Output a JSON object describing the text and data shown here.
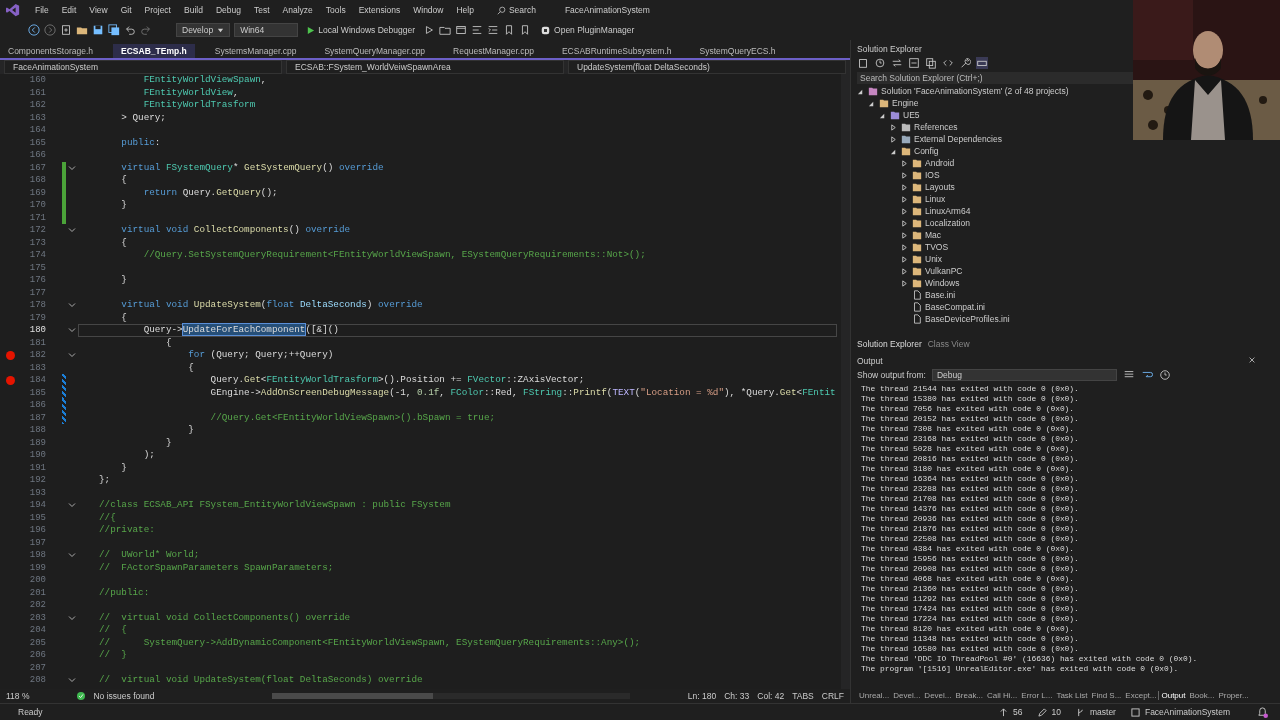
{
  "menu": [
    "File",
    "Edit",
    "View",
    "Git",
    "Project",
    "Build",
    "Debug",
    "Test",
    "Analyze",
    "Tools",
    "Extensions",
    "Window",
    "Help"
  ],
  "search_label": "Search",
  "window_title": "FaceAnimationSystem",
  "toolbar": {
    "configuration": "Develop",
    "platform": "Win64",
    "debugger": "Local Windows Debugger",
    "plugin_button": "Open PluginManager"
  },
  "tabs": [
    {
      "label": "ComponentsStorage.h",
      "selected": false
    },
    {
      "label": "ECSAB_TEmp.h",
      "selected": true
    },
    {
      "label": "SystemsManager.cpp",
      "selected": false
    },
    {
      "label": "SystemQueryManager.cpp",
      "selected": false
    },
    {
      "label": "RequestManager.cpp",
      "selected": false
    },
    {
      "label": "ECSABRuntimeSubsystem.h",
      "selected": false
    },
    {
      "label": "SystemQueryECS.h",
      "selected": false
    }
  ],
  "navigation": {
    "project": "FaceAnimationSystem",
    "scope": "ECSAB::FSystem_WorldVeiwSpawnArea",
    "member": "UpdateSystem(float DeltaSeconds)"
  },
  "code_lines": [
    {
      "n": "160",
      "fold": false,
      "breakpoint": false,
      "current": false,
      "saved_change": false,
      "unsaved_change": false,
      "code": [
        {
          "kind": "type",
          "text": "        FEntityWorldViewSpawn"
        },
        {
          "kind": "plain",
          "text": ","
        }
      ]
    },
    {
      "n": "161",
      "fold": false,
      "breakpoint": false,
      "current": false,
      "saved_change": false,
      "unsaved_change": false,
      "code": [
        {
          "kind": "type",
          "text": "        FEntityWorldView"
        },
        {
          "kind": "plain",
          "text": ","
        }
      ]
    },
    {
      "n": "162",
      "fold": false,
      "breakpoint": false,
      "current": false,
      "saved_change": false,
      "unsaved_change": false,
      "code": [
        {
          "kind": "type",
          "text": "        FEntityWorldTrasform"
        }
      ]
    },
    {
      "n": "163",
      "fold": false,
      "breakpoint": false,
      "current": false,
      "saved_change": false,
      "unsaved_change": false,
      "code": [
        {
          "kind": "plain",
          "text": "    > Query;"
        }
      ]
    },
    {
      "n": "164",
      "fold": false,
      "breakpoint": false,
      "current": false,
      "saved_change": false,
      "unsaved_change": false
    },
    {
      "n": "165",
      "fold": false,
      "breakpoint": false,
      "current": false,
      "saved_change": false,
      "unsaved_change": false,
      "code": [
        {
          "kind": "keyword",
          "text": "    public"
        },
        {
          "kind": "plain",
          "text": ":"
        }
      ]
    },
    {
      "n": "166",
      "fold": false,
      "breakpoint": false,
      "current": false,
      "saved_change": false,
      "unsaved_change": false
    },
    {
      "n": "167",
      "fold": true,
      "breakpoint": false,
      "current": false,
      "saved_change": true,
      "unsaved_change": false,
      "code": [
        {
          "kind": "keyword",
          "text": "    virtual "
        },
        {
          "kind": "type",
          "text": "FSystemQuery"
        },
        {
          "kind": "plain",
          "text": "* "
        },
        {
          "kind": "function",
          "text": "GetSystemQuery"
        },
        {
          "kind": "plain",
          "text": "() "
        },
        {
          "kind": "keyword",
          "text": "override"
        }
      ]
    },
    {
      "n": "168",
      "fold": false,
      "breakpoint": false,
      "current": false,
      "saved_change": true,
      "unsaved_change": false,
      "code": [
        {
          "kind": "plain",
          "text": "    {"
        }
      ]
    },
    {
      "n": "169",
      "fold": false,
      "breakpoint": false,
      "current": false,
      "saved_change": true,
      "unsaved_change": false,
      "code": [
        {
          "kind": "keyword",
          "text": "        return "
        },
        {
          "kind": "plain",
          "text": "Query."
        },
        {
          "kind": "function",
          "text": "GetQuery"
        },
        {
          "kind": "plain",
          "text": "();"
        }
      ]
    },
    {
      "n": "170",
      "fold": false,
      "breakpoint": false,
      "current": false,
      "saved_change": true,
      "unsaved_change": false,
      "code": [
        {
          "kind": "plain",
          "text": "    }"
        }
      ]
    },
    {
      "n": "171",
      "fold": false,
      "breakpoint": false,
      "current": false,
      "saved_change": true,
      "unsaved_change": false
    },
    {
      "n": "172",
      "fold": true,
      "breakpoint": false,
      "current": false,
      "saved_change": false,
      "unsaved_change": false,
      "code": [
        {
          "kind": "keyword",
          "text": "    virtual void "
        },
        {
          "kind": "function",
          "text": "CollectComponents"
        },
        {
          "kind": "plain",
          "text": "() "
        },
        {
          "kind": "keyword",
          "text": "override"
        }
      ]
    },
    {
      "n": "173",
      "fold": false,
      "breakpoint": false,
      "current": false,
      "saved_change": false,
      "unsaved_change": false,
      "code": [
        {
          "kind": "plain",
          "text": "    {"
        }
      ]
    },
    {
      "n": "174",
      "fold": false,
      "breakpoint": false,
      "current": false,
      "saved_change": false,
      "unsaved_change": false,
      "code": [
        {
          "kind": "comment",
          "text": "        //Query.SetSystemQueryRequirement<FEntityWorldViewSpawn, ESystemQueryRequirements::Not>();"
        }
      ]
    },
    {
      "n": "175",
      "fold": false,
      "breakpoint": false,
      "current": false,
      "saved_change": false,
      "unsaved_change": false
    },
    {
      "n": "176",
      "fold": false,
      "breakpoint": false,
      "current": false,
      "saved_change": false,
      "unsaved_change": false,
      "code": [
        {
          "kind": "plain",
          "text": "    }"
        }
      ]
    },
    {
      "n": "177",
      "fold": false,
      "breakpoint": false,
      "current": false,
      "saved_change": false,
      "unsaved_change": false
    },
    {
      "n": "178",
      "fold": true,
      "breakpoint": false,
      "current": false,
      "saved_change": false,
      "unsaved_change": false,
      "code": [
        {
          "kind": "keyword",
          "text": "    virtual void "
        },
        {
          "kind": "function",
          "text": "UpdateSystem"
        },
        {
          "kind": "plain",
          "text": "("
        },
        {
          "kind": "keyword",
          "text": "float "
        },
        {
          "kind": "variable",
          "text": "DeltaSeconds"
        },
        {
          "kind": "plain",
          "text": ") "
        },
        {
          "kind": "keyword",
          "text": "override"
        }
      ]
    },
    {
      "n": "179",
      "fold": false,
      "breakpoint": false,
      "current": false,
      "saved_change": false,
      "unsaved_change": false,
      "code": [
        {
          "kind": "plain",
          "text": "    {"
        }
      ]
    },
    {
      "n": "180",
      "fold": true,
      "breakpoint": false,
      "current": true,
      "saved_change": false,
      "unsaved_change": false,
      "code": [
        {
          "kind": "plain",
          "text": "        Query->"
        },
        {
          "kind": "selection",
          "text": "UpdateForEachComponent"
        },
        {
          "kind": "plain",
          "text": "([&]()"
        }
      ]
    },
    {
      "n": "181",
      "fold": false,
      "breakpoint": false,
      "current": false,
      "saved_change": false,
      "unsaved_change": false,
      "code": [
        {
          "kind": "plain",
          "text": "            {"
        }
      ]
    },
    {
      "n": "182",
      "fold": true,
      "breakpoint": true,
      "current": false,
      "saved_change": false,
      "unsaved_change": false,
      "code": [
        {
          "kind": "keyword",
          "text": "                for "
        },
        {
          "kind": "plain",
          "text": "(Query; Query;++Query)"
        }
      ]
    },
    {
      "n": "183",
      "fold": false,
      "breakpoint": false,
      "current": false,
      "saved_change": false,
      "unsaved_change": false,
      "code": [
        {
          "kind": "plain",
          "text": "                {"
        }
      ]
    },
    {
      "n": "184",
      "fold": false,
      "breakpoint": true,
      "current": false,
      "saved_change": false,
      "unsaved_change": true,
      "code": [
        {
          "kind": "plain",
          "text": "                    Query."
        },
        {
          "kind": "function",
          "text": "Get"
        },
        {
          "kind": "plain",
          "text": "<"
        },
        {
          "kind": "type",
          "text": "FEntityWorldTrasform"
        },
        {
          "kind": "plain",
          "text": ">().Position += "
        },
        {
          "kind": "type",
          "text": "FVector"
        },
        {
          "kind": "plain",
          "text": "::ZAxisVector;"
        }
      ]
    },
    {
      "n": "185",
      "fold": false,
      "breakpoint": false,
      "current": false,
      "saved_change": false,
      "unsaved_change": true,
      "code": [
        {
          "kind": "plain",
          "text": "                    GEngine->"
        },
        {
          "kind": "function",
          "text": "AddOnScreenDebugMessage"
        },
        {
          "kind": "plain",
          "text": "(-1, "
        },
        {
          "kind": "number",
          "text": "0.1f"
        },
        {
          "kind": "plain",
          "text": ", "
        },
        {
          "kind": "type",
          "text": "FColor"
        },
        {
          "kind": "plain",
          "text": "::Red, "
        },
        {
          "kind": "type",
          "text": "FString"
        },
        {
          "kind": "plain",
          "text": "::"
        },
        {
          "kind": "function",
          "text": "Printf"
        },
        {
          "kind": "plain",
          "text": "("
        },
        {
          "kind": "macro",
          "text": "TEXT"
        },
        {
          "kind": "plain",
          "text": "("
        },
        {
          "kind": "string",
          "text": "\"Location = %d\""
        },
        {
          "kind": "plain",
          "text": "), *Query."
        },
        {
          "kind": "function",
          "text": "Get"
        },
        {
          "kind": "plain",
          "text": "<"
        },
        {
          "kind": "type",
          "text": "FEntit"
        }
      ]
    },
    {
      "n": "186",
      "fold": false,
      "breakpoint": false,
      "current": false,
      "saved_change": false,
      "unsaved_change": true
    },
    {
      "n": "187",
      "fold": false,
      "breakpoint": false,
      "current": false,
      "saved_change": false,
      "unsaved_change": true,
      "code": [
        {
          "kind": "comment",
          "text": "                    //Query.Get<FEntityWorldViewSpawn>().bSpawn = true;"
        }
      ]
    },
    {
      "n": "188",
      "fold": false,
      "breakpoint": false,
      "current": false,
      "saved_change": false,
      "unsaved_change": false,
      "code": [
        {
          "kind": "plain",
          "text": "                }"
        }
      ]
    },
    {
      "n": "189",
      "fold": false,
      "breakpoint": false,
      "current": false,
      "saved_change": false,
      "unsaved_change": false,
      "code": [
        {
          "kind": "plain",
          "text": "            }"
        }
      ]
    },
    {
      "n": "190",
      "fold": false,
      "breakpoint": false,
      "current": false,
      "saved_change": false,
      "unsaved_change": false,
      "code": [
        {
          "kind": "plain",
          "text": "        );"
        }
      ]
    },
    {
      "n": "191",
      "fold": false,
      "breakpoint": false,
      "current": false,
      "saved_change": false,
      "unsaved_change": false,
      "code": [
        {
          "kind": "plain",
          "text": "    }"
        }
      ]
    },
    {
      "n": "192",
      "fold": false,
      "breakpoint": false,
      "current": false,
      "saved_change": false,
      "unsaved_change": false,
      "code": [
        {
          "kind": "plain",
          "text": "};"
        }
      ]
    },
    {
      "n": "193",
      "fold": false,
      "breakpoint": false,
      "current": false,
      "saved_change": false,
      "unsaved_change": false
    },
    {
      "n": "194",
      "fold": true,
      "breakpoint": false,
      "current": false,
      "saved_change": false,
      "unsaved_change": false,
      "code": [
        {
          "kind": "comment",
          "text": "//class ECSAB_API FSystem_EntityWorldViewSpawn : public FSystem"
        }
      ]
    },
    {
      "n": "195",
      "fold": false,
      "breakpoint": false,
      "current": false,
      "saved_change": false,
      "unsaved_change": false,
      "code": [
        {
          "kind": "comment",
          "text": "//{"
        }
      ]
    },
    {
      "n": "196",
      "fold": false,
      "breakpoint": false,
      "current": false,
      "saved_change": false,
      "unsaved_change": false,
      "code": [
        {
          "kind": "comment",
          "text": "//private:"
        }
      ]
    },
    {
      "n": "197",
      "fold": false,
      "breakpoint": false,
      "current": false,
      "saved_change": false,
      "unsaved_change": false
    },
    {
      "n": "198",
      "fold": true,
      "breakpoint": false,
      "current": false,
      "saved_change": false,
      "unsaved_change": false,
      "code": [
        {
          "kind": "comment",
          "text": "//  UWorld* World;"
        }
      ]
    },
    {
      "n": "199",
      "fold": false,
      "breakpoint": false,
      "current": false,
      "saved_change": false,
      "unsaved_change": false,
      "code": [
        {
          "kind": "comment",
          "text": "//  FActorSpawnParameters SpawnParameters;"
        }
      ]
    },
    {
      "n": "200",
      "fold": false,
      "breakpoint": false,
      "current": false,
      "saved_change": false,
      "unsaved_change": false
    },
    {
      "n": "201",
      "fold": false,
      "breakpoint": false,
      "current": false,
      "saved_change": false,
      "unsaved_change": false,
      "code": [
        {
          "kind": "comment",
          "text": "//public:"
        }
      ]
    },
    {
      "n": "202",
      "fold": false,
      "breakpoint": false,
      "current": false,
      "saved_change": false,
      "unsaved_change": false
    },
    {
      "n": "203",
      "fold": true,
      "breakpoint": false,
      "current": false,
      "saved_change": false,
      "unsaved_change": false,
      "code": [
        {
          "kind": "comment",
          "text": "//  virtual void CollectComponents() override"
        }
      ]
    },
    {
      "n": "204",
      "fold": false,
      "breakpoint": false,
      "current": false,
      "saved_change": false,
      "unsaved_change": false,
      "code": [
        {
          "kind": "comment",
          "text": "//  {"
        }
      ]
    },
    {
      "n": "205",
      "fold": false,
      "breakpoint": false,
      "current": false,
      "saved_change": false,
      "unsaved_change": false,
      "code": [
        {
          "kind": "comment",
          "text": "//      SystemQuery->AddDynamicComponent<FEntityWorldViewSpawn, ESystemQueryRequirements::Any>();"
        }
      ]
    },
    {
      "n": "206",
      "fold": false,
      "breakpoint": false,
      "current": false,
      "saved_change": false,
      "unsaved_change": false,
      "code": [
        {
          "kind": "comment",
          "text": "//  }"
        }
      ]
    },
    {
      "n": "207",
      "fold": false,
      "breakpoint": false,
      "current": false,
      "saved_change": false,
      "unsaved_change": false
    },
    {
      "n": "208",
      "fold": true,
      "breakpoint": false,
      "current": false,
      "saved_change": false,
      "unsaved_change": false,
      "code": [
        {
          "kind": "comment",
          "text": "//  virtual void UpdateSystem(float DeltaSeconds) override"
        }
      ]
    }
  ],
  "editor_status": {
    "zoom": "118 %",
    "issues": "No issues found",
    "line": "Ln: 180",
    "char": "Ch: 33",
    "col": "Col: 42",
    "indent": "TABS",
    "eol": "CRLF"
  },
  "solution_explorer": {
    "title": "Solution Explorer",
    "search_placeholder": "Search Solution Explorer (Ctrl+;)",
    "tree": [
      {
        "label": "Solution 'FaceAnimationSystem' (2 of 48 projects)",
        "kind": "solution",
        "expanded": true,
        "children": [
          {
            "label": "Engine",
            "kind": "folder",
            "expanded": true,
            "children": [
              {
                "label": "UE5",
                "kind": "project",
                "expanded": true,
                "children": [
                  {
                    "label": "References",
                    "kind": "references",
                    "expanded": false
                  },
                  {
                    "label": "External Dependencies",
                    "kind": "dependencies",
                    "expanded": false
                  },
                  {
                    "label": "Config",
                    "kind": "filter",
                    "expanded": true,
                    "children": [
                      {
                        "label": "Android",
                        "kind": "filter",
                        "expanded": false
                      },
                      {
                        "label": "IOS",
                        "kind": "filter",
                        "expanded": false
                      },
                      {
                        "label": "Layouts",
                        "kind": "filter",
                        "expanded": false
                      },
                      {
                        "label": "Linux",
                        "kind": "filter",
                        "expanded": false
                      },
                      {
                        "label": "LinuxArm64",
                        "kind": "filter",
                        "expanded": false
                      },
                      {
                        "label": "Localization",
                        "kind": "filter",
                        "expanded": false
                      },
                      {
                        "label": "Mac",
                        "kind": "filter",
                        "expanded": false
                      },
                      {
                        "label": "TVOS",
                        "kind": "filter",
                        "expanded": false
                      },
                      {
                        "label": "Unix",
                        "kind": "filter",
                        "expanded": false
                      },
                      {
                        "label": "VulkanPC",
                        "kind": "filter",
                        "expanded": false
                      },
                      {
                        "label": "Windows",
                        "kind": "filter",
                        "expanded": false
                      },
                      {
                        "label": "Base.ini",
                        "kind": "file"
                      },
                      {
                        "label": "BaseCompat.ini",
                        "kind": "file"
                      },
                      {
                        "label": "BaseDeviceProfiles.ini",
                        "kind": "file"
                      }
                    ]
                  }
                ]
              }
            ]
          }
        ]
      }
    ],
    "bottom_tabs": [
      {
        "label": "Solution Explorer",
        "selected": true
      },
      {
        "label": "Class View",
        "selected": false
      }
    ]
  },
  "output": {
    "title": "Output",
    "source_label": "Show output from:",
    "source": "Debug",
    "lines": [
      "The thread 21544 has exited with code 0 (0x0).",
      "The thread 15380 has exited with code 0 (0x0).",
      "The thread 7056 has exited with code 0 (0x0).",
      "The thread 20152 has exited with code 0 (0x0).",
      "The thread 7308 has exited with code 0 (0x0).",
      "The thread 23168 has exited with code 0 (0x0).",
      "The thread 5028 has exited with code 0 (0x0).",
      "The thread 20816 has exited with code 0 (0x0).",
      "The thread 3180 has exited with code 0 (0x0).",
      "The thread 16364 has exited with code 0 (0x0).",
      "The thread 23288 has exited with code 0 (0x0).",
      "The thread 21708 has exited with code 0 (0x0).",
      "The thread 14376 has exited with code 0 (0x0).",
      "The thread 20936 has exited with code 0 (0x0).",
      "The thread 21876 has exited with code 0 (0x0).",
      "The thread 22508 has exited with code 0 (0x0).",
      "The thread 4384 has exited with code 0 (0x0).",
      "The thread 15956 has exited with code 0 (0x0).",
      "The thread 20908 has exited with code 0 (0x0).",
      "The thread 4068 has exited with code 0 (0x0).",
      "The thread 21360 has exited with code 0 (0x0).",
      "The thread 11292 has exited with code 0 (0x0).",
      "The thread 17424 has exited with code 0 (0x0).",
      "The thread 17224 has exited with code 0 (0x0).",
      "The thread 8120 has exited with code 0 (0x0).",
      "The thread 11348 has exited with code 0 (0x0).",
      "The thread 16580 has exited with code 0 (0x0).",
      "The thread 'DDC IO ThreadPool #0' (16636) has exited with code 0 (0x0).",
      "The program '[1516] UnrealEditor.exe' has exited with code 0 (0x0)."
    ]
  },
  "tool_tabs": [
    {
      "label": "Unreal...",
      "selected": false
    },
    {
      "label": "Devel...",
      "selected": false
    },
    {
      "label": "Devel...",
      "selected": false
    },
    {
      "label": "Break...",
      "selected": false
    },
    {
      "label": "Call Hi...",
      "selected": false
    },
    {
      "label": "Error L...",
      "selected": false
    },
    {
      "label": "Task List",
      "selected": false
    },
    {
      "label": "Find S...",
      "selected": false
    },
    {
      "label": "Except...",
      "selected": false
    },
    {
      "label": "Output",
      "selected": true
    },
    {
      "label": "Book...",
      "selected": false
    },
    {
      "label": "Proper...",
      "selected": false
    }
  ],
  "status_bar": {
    "message": "Ready",
    "incoming": "56",
    "changes": "10",
    "branch": "master",
    "repository": "FaceAnimationSystem"
  },
  "webcam": {
    "kind": "picture"
  }
}
